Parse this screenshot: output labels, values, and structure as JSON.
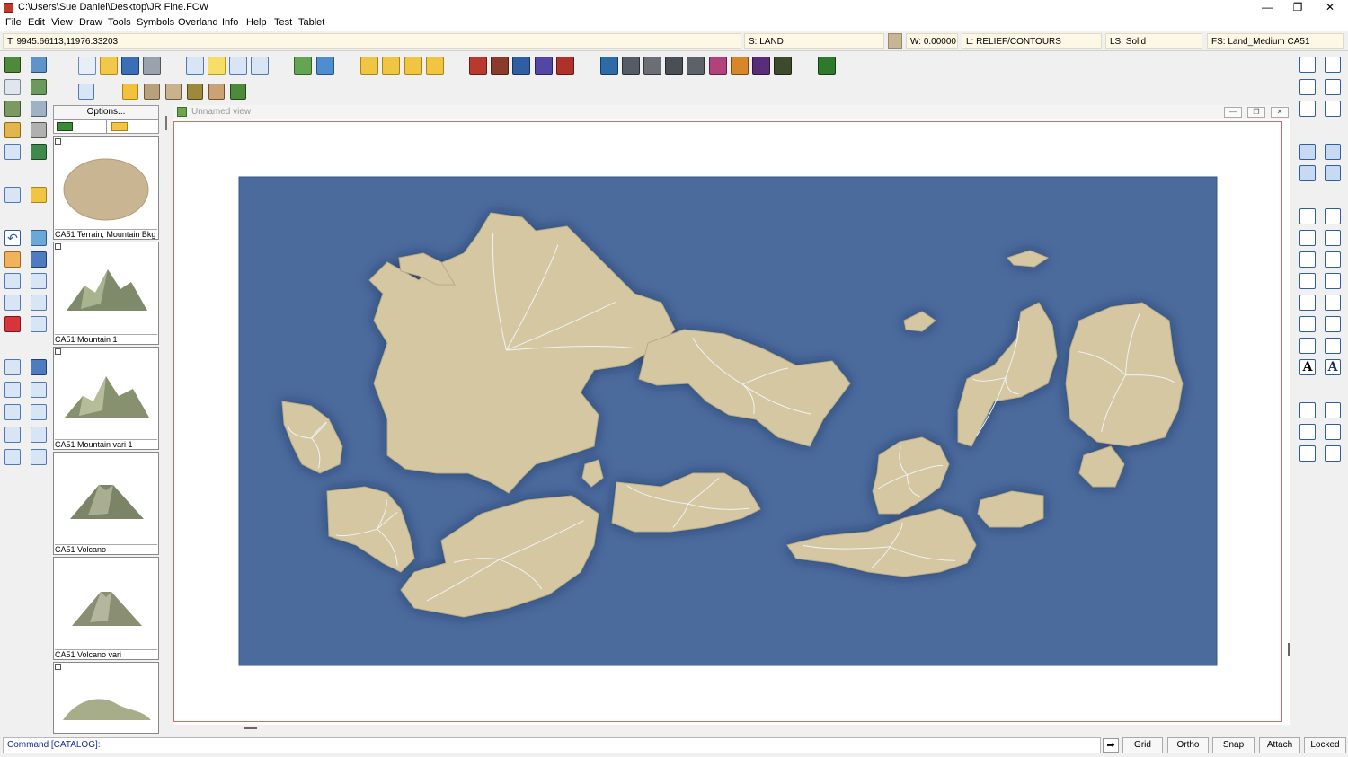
{
  "window": {
    "title": "C:\\Users\\Sue Daniel\\Desktop\\JR Fine.FCW",
    "minimize": "—",
    "maximize": "❐",
    "close": "✕"
  },
  "menu": [
    "File",
    "Edit",
    "View",
    "Draw",
    "Tools",
    "Symbols",
    "Overland",
    "Info",
    "Help",
    "Test",
    "Tablet"
  ],
  "status": {
    "coords": "T: 9945.66113,11976.33203",
    "sheet": "S: LAND",
    "width": "W: 0.00000",
    "layer": "L: RELIEF/CONTOURS",
    "line_style": "LS: Solid",
    "fill_style": "FS: Land_Medium CA51"
  },
  "catalog": {
    "options_label": "Options...",
    "items": [
      {
        "label": "CA51 Terrain, Mountain Bkg"
      },
      {
        "label": "CA51 Mountain 1"
      },
      {
        "label": "CA51 Mountain vari 1"
      },
      {
        "label": "CA51 Volcano"
      },
      {
        "label": "CA51 Volcano vari"
      },
      {
        "label": ""
      }
    ]
  },
  "map_view": {
    "title": "Unnamed view",
    "colors": {
      "sea": "#4a6a9c",
      "land": "#d6c7a3",
      "river": "#eef3f7"
    }
  },
  "command": {
    "prompt": "Command [CATALOG]:"
  },
  "modes": [
    "Grid",
    "Ortho",
    "Snap",
    "Attach",
    "Locked"
  ]
}
